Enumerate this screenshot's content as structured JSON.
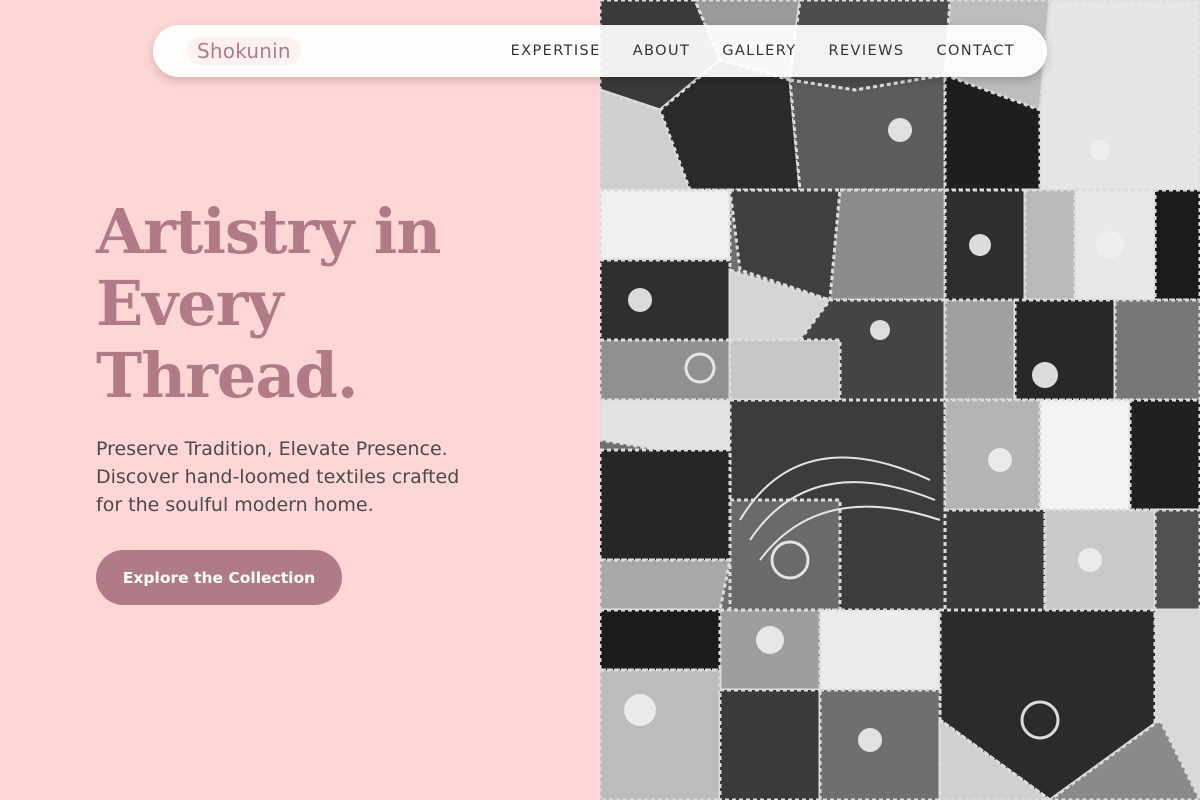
{
  "brand": {
    "name": "Shokunin",
    "accent_color": "#b07b86",
    "background_color": "#ffd6d6"
  },
  "nav": {
    "items": [
      {
        "label": "EXPERTISE"
      },
      {
        "label": "ABOUT"
      },
      {
        "label": "GALLERY"
      },
      {
        "label": "REVIEWS"
      },
      {
        "label": "CONTACT"
      }
    ]
  },
  "hero": {
    "headline_lines": [
      "Artistry in",
      "Every",
      "Thread."
    ],
    "subtext_lines": [
      "Preserve Tradition, Elevate Presence.",
      "Discover hand-loomed textiles crafted",
      "for the soulful modern home."
    ],
    "cta_label": "Explore the Collection"
  },
  "image": {
    "subject": "black-and-white crazy quilt with embroidered patches"
  }
}
